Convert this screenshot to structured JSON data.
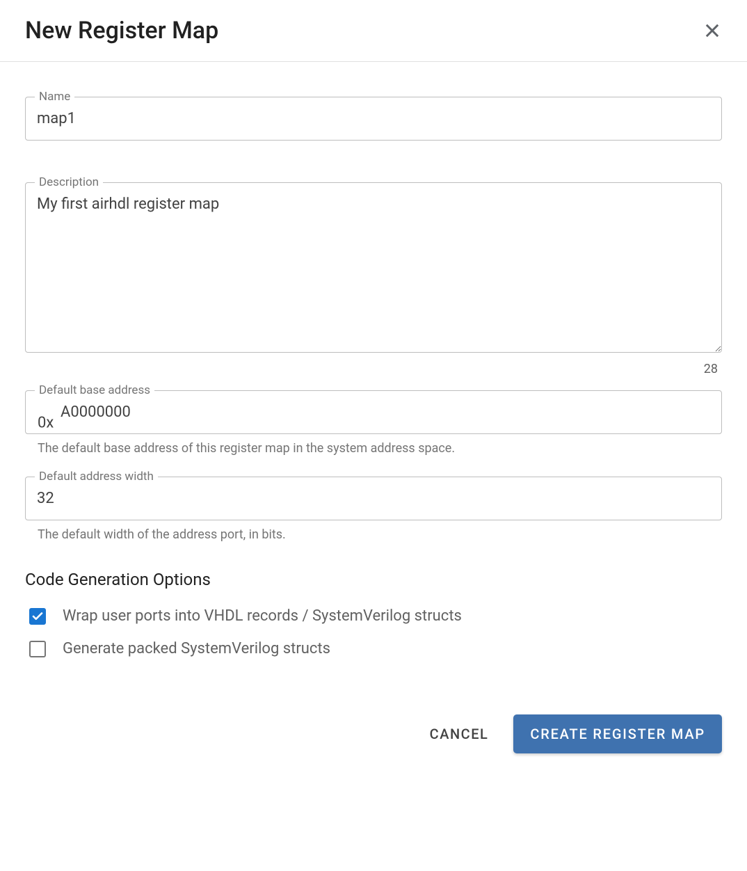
{
  "dialog": {
    "title": "New Register Map"
  },
  "fields": {
    "name": {
      "label": "Name",
      "value": "map1"
    },
    "description": {
      "label": "Description",
      "value": "My first airhdl register map",
      "char_count": "28"
    },
    "base_address": {
      "label": "Default base address",
      "prefix": "0x",
      "value": "A0000000",
      "helper": "The default base address of this register map in the system address space."
    },
    "address_width": {
      "label": "Default address width",
      "value": "32",
      "helper": "The default width of the address port, in bits."
    }
  },
  "codegen": {
    "title": "Code Generation Options",
    "options": [
      {
        "label": "Wrap user ports into VHDL records / SystemVerilog structs",
        "checked": true
      },
      {
        "label": "Generate packed SystemVerilog structs",
        "checked": false
      }
    ]
  },
  "actions": {
    "cancel": "CANCEL",
    "create": "CREATE REGISTER MAP"
  }
}
